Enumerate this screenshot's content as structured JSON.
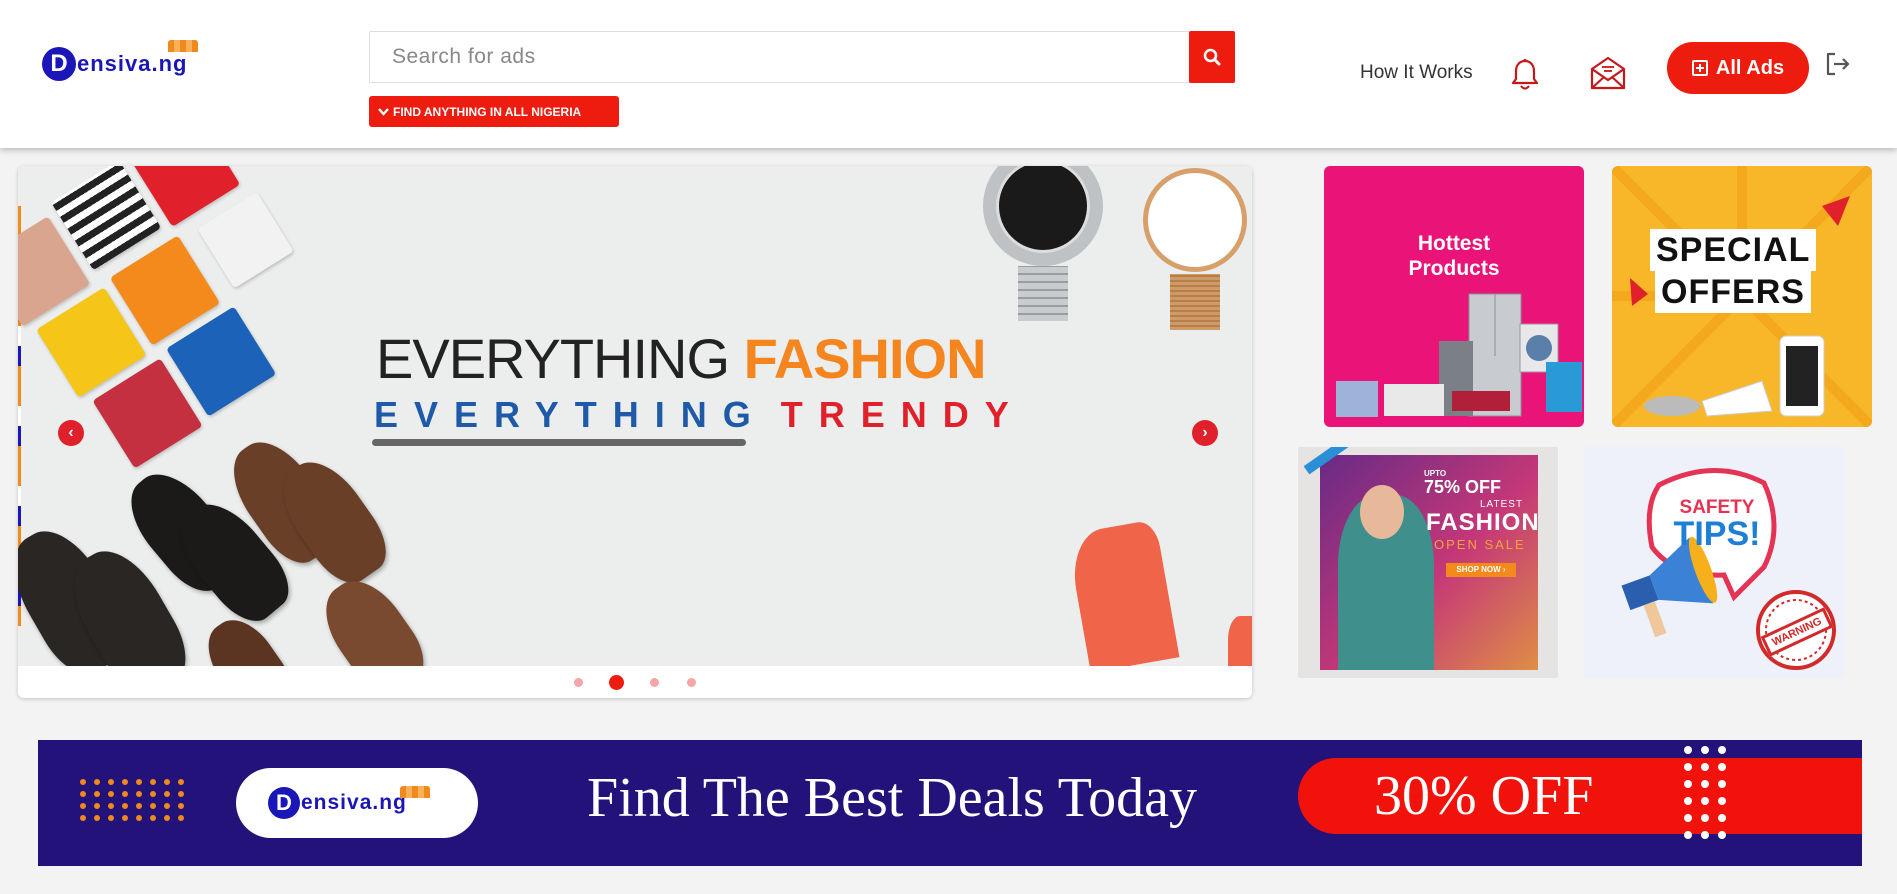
{
  "header": {
    "logo": {
      "initial": "D",
      "name_part1": "ensiva",
      "name_part2": ".ng"
    },
    "search": {
      "placeholder": "Search for ads"
    },
    "location_button": "FIND ANYTHING IN ALL NIGERIA",
    "nav": {
      "how_it_works": "How It Works",
      "all_ads": "All Ads"
    },
    "icons": [
      "search-icon",
      "chevron-down-icon",
      "bell-icon",
      "envelope-icon",
      "plus-square-icon",
      "logout-icon"
    ]
  },
  "carousel": {
    "headline_part1": "EVERYTHING ",
    "headline_part2": "FASHION",
    "subline_part1": "EVERYTHING",
    "subline_part2": "TRENDY",
    "prev_icon": "‹",
    "next_icon": "›",
    "slides_count": 4,
    "active_slide": 2
  },
  "tiles": {
    "hottest": {
      "line1": "Hottest",
      "line2": "Products"
    },
    "special": {
      "line1": "SPECIAL",
      "line2": "OFFERS"
    },
    "fashion": {
      "upto": "UPTO",
      "percent": "75% OFF",
      "latest": "LATEST",
      "title": "FASHION",
      "open_sale": "OPEN SALE",
      "cta": "SHOP NOW ›"
    },
    "safety": {
      "line1": "SAFETY",
      "line2": "TIPS!",
      "stamp": "WARNING"
    }
  },
  "banner": {
    "logo": {
      "initial": "D",
      "name_part1": "ensiva",
      "name_part2": ".ng"
    },
    "text": "Find The Best Deals Today",
    "offer": "30% OFF"
  },
  "colors": {
    "accent_red": "#ee1c0e",
    "brand_blue": "#1a16b8",
    "brand_orange": "#f08a1c",
    "banner_navy": "#221279"
  }
}
